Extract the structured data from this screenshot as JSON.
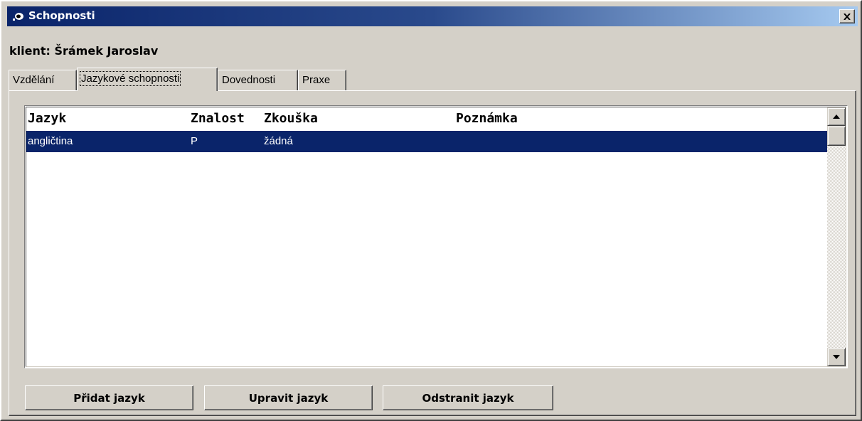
{
  "window": {
    "title": "Schopnosti",
    "close_symbol": "✕"
  },
  "client": {
    "label": "klient: Šrámek Jaroslav"
  },
  "tabs": [
    {
      "label": "Vzdělání"
    },
    {
      "label": "Jazykové schopnosti"
    },
    {
      "label": "Dovednosti"
    },
    {
      "label": "Praxe"
    }
  ],
  "active_tab": "Jazykové schopnosti",
  "table": {
    "columns": [
      "Jazyk",
      "Znalost",
      "Zkouška",
      "Poznámka"
    ],
    "rows": [
      {
        "jazyk": "angličtina",
        "znalost": "P",
        "zkouska": "žádná",
        "poznamka": "",
        "selected": true
      }
    ]
  },
  "buttons": {
    "add": "Přidat jazyk",
    "edit": "Upravit jazyk",
    "remove": "Odstranit jazyk"
  },
  "colors": {
    "title_start": "#0a246a",
    "title_end": "#a6caf0",
    "selection": "#0a246a",
    "face": "#d4d0c8"
  },
  "icons": {
    "title": "app-icon",
    "close": "close-icon",
    "scroll_up": "arrow-up-icon",
    "scroll_down": "arrow-down-icon"
  }
}
